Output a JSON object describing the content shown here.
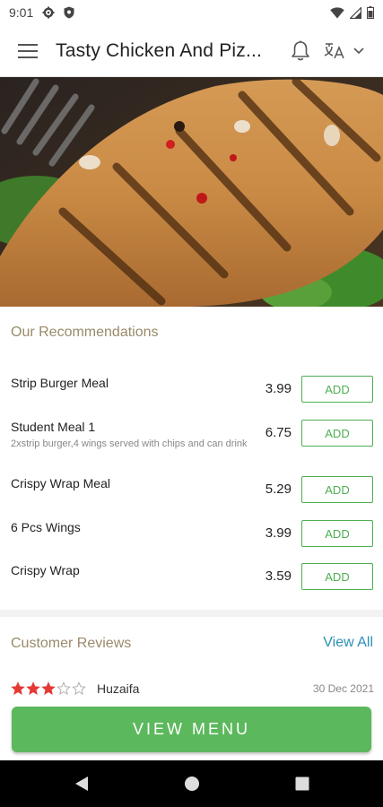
{
  "status_bar": {
    "time": "9:01"
  },
  "header": {
    "title": "Tasty Chicken And Piz...",
    "icons": [
      "menu-icon",
      "bell-icon",
      "language-icon",
      "chevron-down-icon"
    ]
  },
  "hero": {
    "image": "grilled-chicken-photo"
  },
  "recommendations": {
    "title": "Our Recommendations",
    "add_label": "ADD",
    "items": [
      {
        "name": "Strip Burger Meal",
        "price": "3.99",
        "description": ""
      },
      {
        "name": "Student Meal 1",
        "price": "6.75",
        "description": "2xstrip burger,4 wings served with chips and can drink"
      },
      {
        "name": "Crispy Wrap Meal",
        "price": "5.29",
        "description": ""
      },
      {
        "name": "6 Pcs Wings",
        "price": "3.99",
        "description": ""
      },
      {
        "name": "Crispy Wrap",
        "price": "3.59",
        "description": ""
      }
    ]
  },
  "reviews": {
    "title": "Customer Reviews",
    "view_all": "View All",
    "items": [
      {
        "reviewer": "Huzaifa",
        "date": "30 Dec 2021",
        "rating": 3,
        "max_rating": 5
      }
    ]
  },
  "cta": {
    "label": "VIEW MENU"
  },
  "colors": {
    "accent_green": "#4caf50",
    "cta_green": "#5cb85c",
    "link_blue": "#2b8fb8",
    "star_red": "#e53935",
    "section_title": "#9a8a6a"
  }
}
